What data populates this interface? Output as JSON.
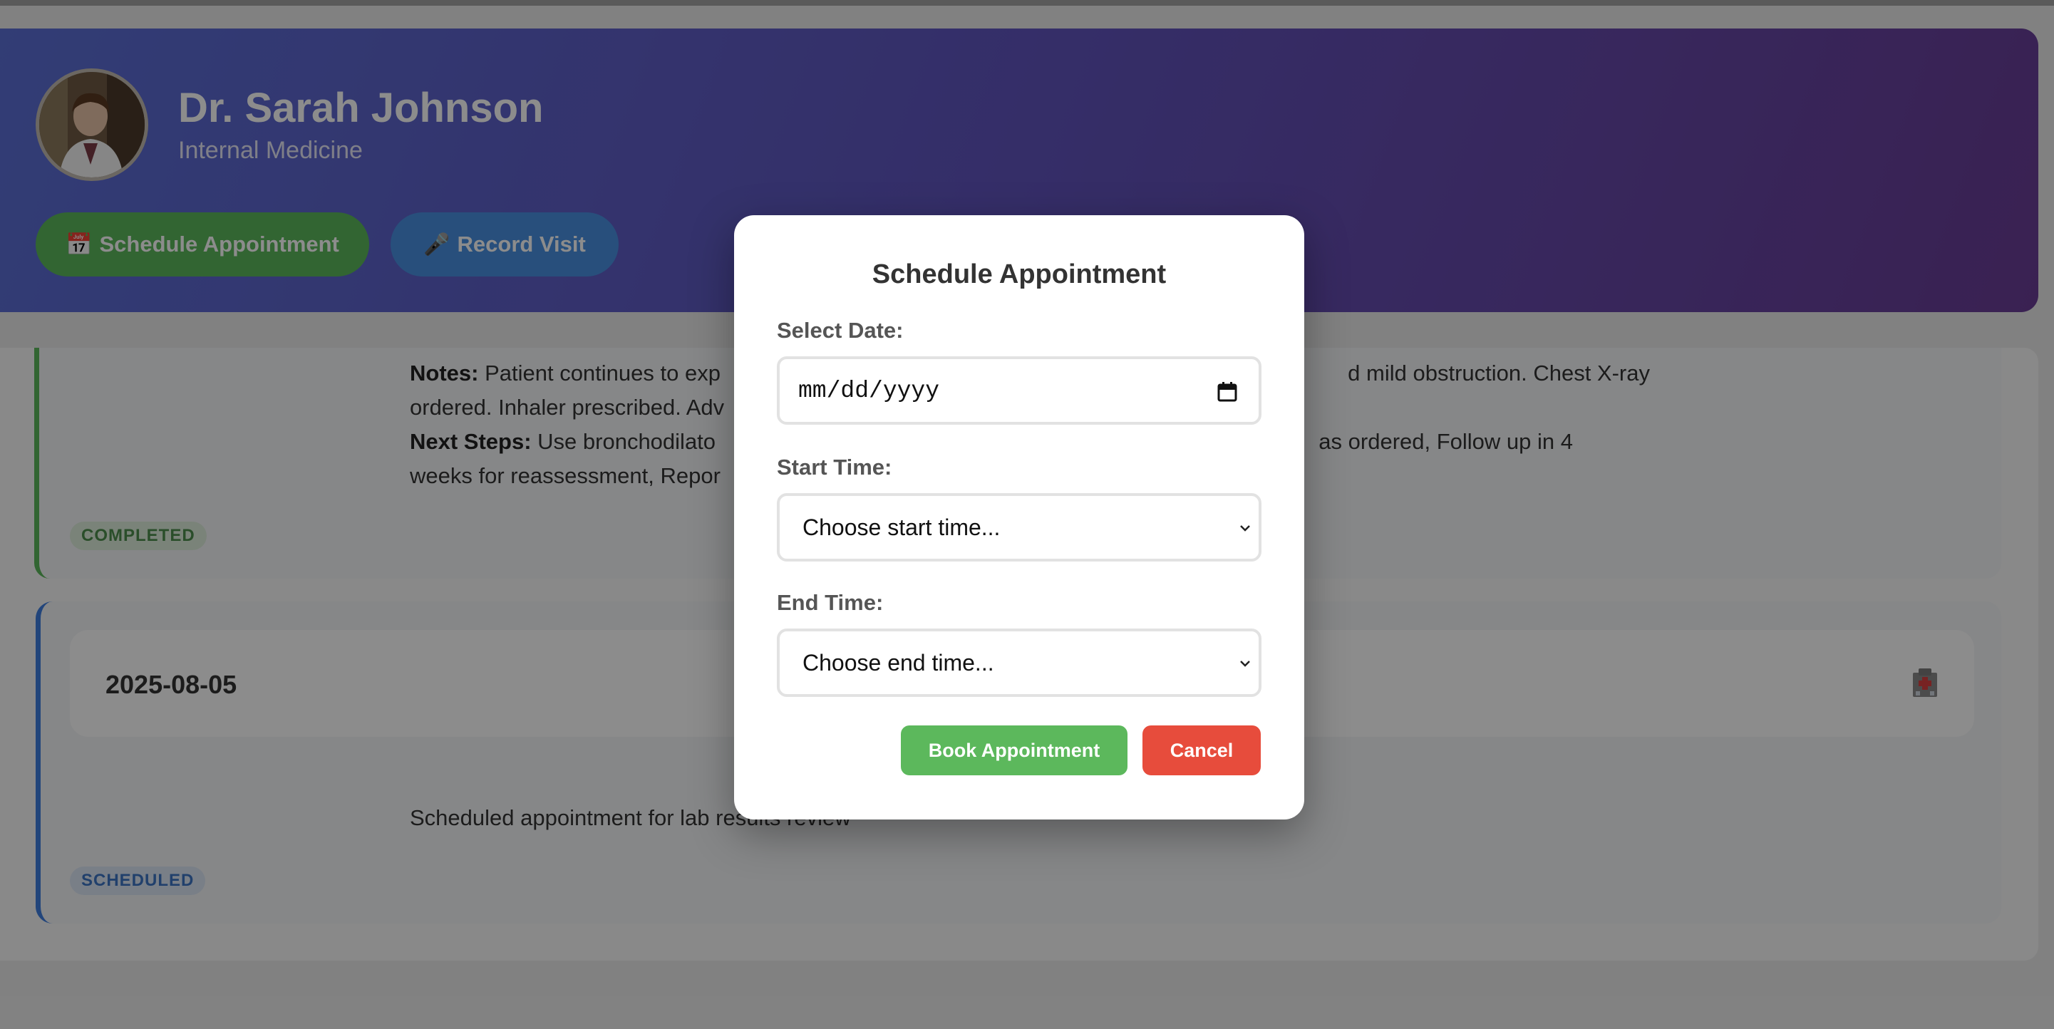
{
  "doctor": {
    "name": "Dr. Sarah Johnson",
    "specialty": "Internal Medicine"
  },
  "actions": {
    "schedule_icon": "📅",
    "schedule_label": "Schedule Appointment",
    "record_icon": "🎤",
    "record_label": "Record Visit"
  },
  "visits": [
    {
      "notes_label": "Notes:",
      "notes_text": " Patient continues to exp",
      "notes_tail": "d mild obstruction. Chest X-ray",
      "notes_line2": "ordered. Inhaler prescribed. Adv",
      "next_label": "Next Steps:",
      "next_text": " Use bronchodilato",
      "next_tail": "as ordered, Follow up in 4",
      "next_line2": "weeks for reassessment, Repor",
      "status": "COMPLETED"
    },
    {
      "date": "2025-08-05",
      "description": "Scheduled appointment for lab results review",
      "status": "SCHEDULED",
      "icon": "hospital-icon"
    }
  ],
  "modal": {
    "title": "Schedule Appointment",
    "date_label": "Select Date:",
    "date_placeholder": "mm/dd/yyyy",
    "start_label": "Start Time:",
    "start_placeholder": "Choose start time...",
    "end_label": "End Time:",
    "end_placeholder": "Choose end time...",
    "book_label": "Book Appointment",
    "cancel_label": "Cancel"
  },
  "colors": {
    "header_start": "#5b6fd6",
    "header_end": "#6a3d96",
    "green": "#5cb85c",
    "blue": "#4a90e2",
    "red": "#e74c3c"
  }
}
